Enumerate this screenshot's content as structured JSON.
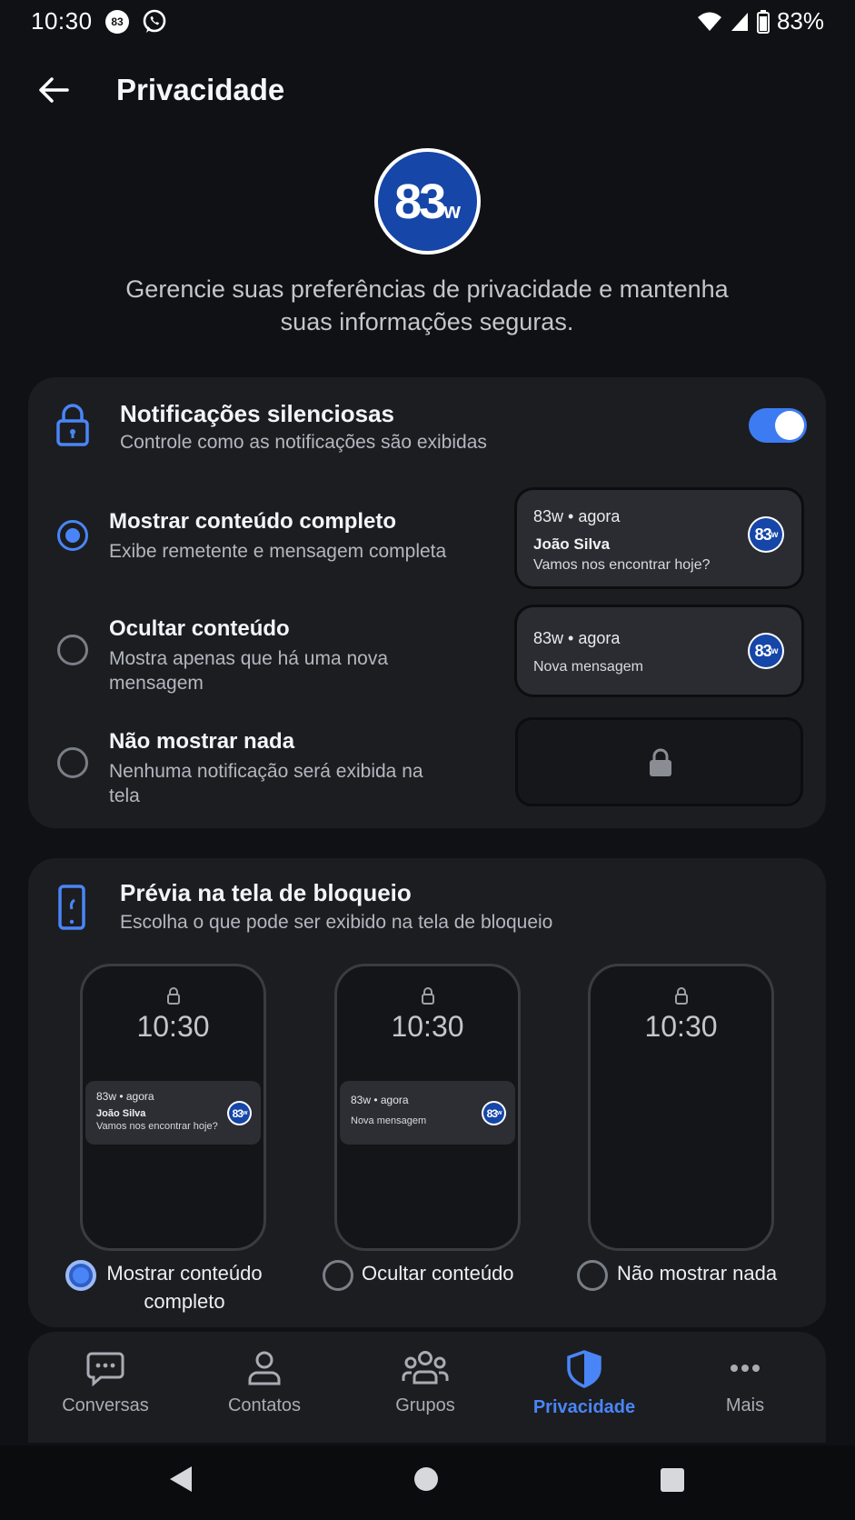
{
  "status_bar": {
    "time": "10:30",
    "badge": "83",
    "battery_pct": "83%"
  },
  "header": {
    "title": "Privacidade"
  },
  "brand": {
    "logo_text": "83",
    "logo_suffix": "w"
  },
  "intro": "Gerencie suas preferências de privacidade e mantenha suas informações seguras.",
  "silent_notifications": {
    "title": "Notificações silenciosas",
    "subtitle": "Controle como as notificações são exibidas",
    "enabled": true,
    "options": [
      {
        "title": "Mostrar conteúdo completo",
        "subtitle": "Exibe remetente e mensagem completa",
        "selected": true
      },
      {
        "title": "Ocultar conteúdo",
        "subtitle": "Mostra apenas que há uma nova mensagem",
        "selected": false
      },
      {
        "title": "Não mostrar nada",
        "subtitle": "Nenhuma notificação será exibida na tela",
        "selected": false
      }
    ],
    "preview_full": {
      "app": "83w • agora",
      "sender": "João Silva",
      "message": "Vamos nos encontrar hoje?"
    },
    "preview_hidden": {
      "app": "83w • agora",
      "message": "Nova mensagem"
    }
  },
  "lockscreen": {
    "title": "Prévia na tela de bloqueio",
    "subtitle": "Escolha o que pode ser exibido na tela de bloqueio",
    "clock": "10:30",
    "options": [
      {
        "label": "Mostrar conteúdo completo",
        "selected": true
      },
      {
        "label": "Ocultar conteúdo",
        "selected": false
      },
      {
        "label": "Não mostrar nada",
        "selected": false
      }
    ],
    "preview_full": {
      "app": "83w • agora",
      "sender": "João Silva",
      "message": "Vamos nos encontrar hoje?"
    },
    "preview_hidden": {
      "app": "83w • agora",
      "message": "Nova mensagem"
    }
  },
  "bottom_nav": [
    {
      "label": "Conversas",
      "icon": "chat-icon",
      "active": false
    },
    {
      "label": "Contatos",
      "icon": "person-icon",
      "active": false
    },
    {
      "label": "Grupos",
      "icon": "group-icon",
      "active": false
    },
    {
      "label": "Privacidade",
      "icon": "shield-icon",
      "active": true
    },
    {
      "label": "Mais",
      "icon": "more-icon",
      "active": false
    }
  ],
  "colors": {
    "accent": "#4a85f7",
    "brand": "#1546a8",
    "background": "#101114",
    "card": "#1b1d21"
  }
}
